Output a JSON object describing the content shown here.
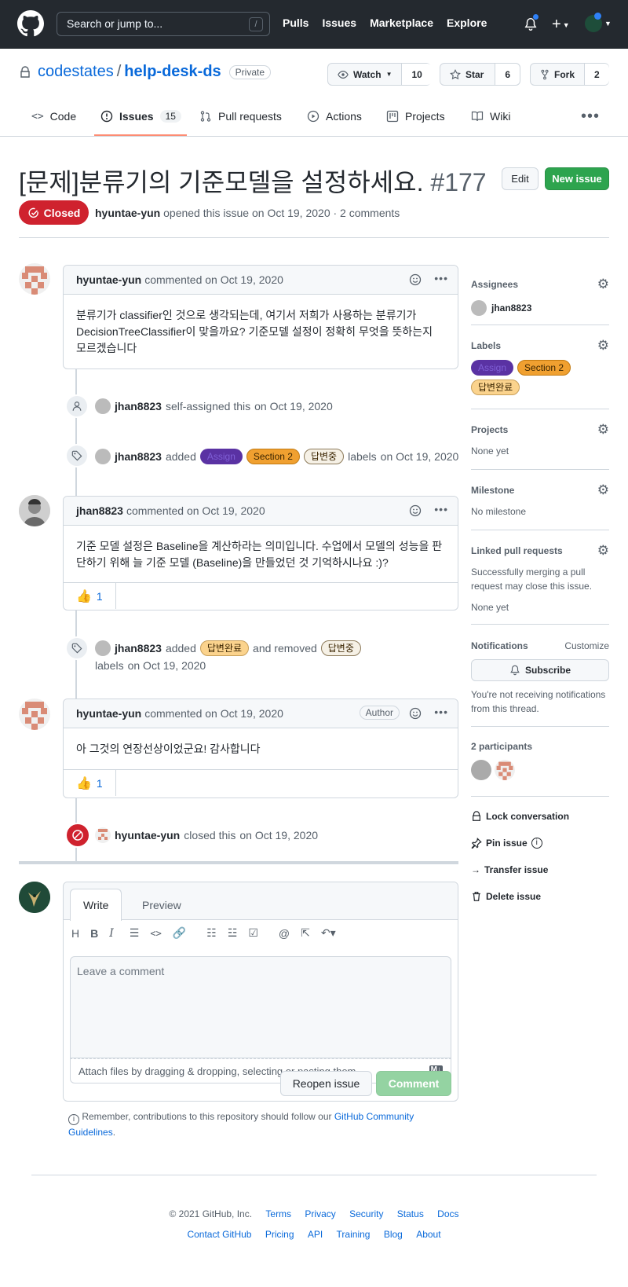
{
  "header": {
    "search_placeholder": "Search or jump to...",
    "slash": "/",
    "nav": [
      "Pulls",
      "Issues",
      "Marketplace",
      "Explore"
    ]
  },
  "repo": {
    "owner": "codestates",
    "sep": "/",
    "name": "help-desk-ds",
    "visibility": "Private",
    "watch_label": "Watch",
    "watch_count": "10",
    "star_label": "Star",
    "star_count": "6",
    "fork_label": "Fork",
    "fork_count": "2"
  },
  "tabs": [
    {
      "label": "Code"
    },
    {
      "label": "Issues",
      "count": "15"
    },
    {
      "label": "Pull requests"
    },
    {
      "label": "Actions"
    },
    {
      "label": "Projects"
    },
    {
      "label": "Wiki"
    }
  ],
  "issue": {
    "title": "[문제]분류기의 기준모델을 설정하세요.",
    "number": "#177",
    "edit_label": "Edit",
    "new_issue_label": "New issue",
    "state": "Closed",
    "author": "hyuntae-yun",
    "meta_rest": "opened this issue on Oct 19, 2020 · 2 comments"
  },
  "comments": [
    {
      "author": "hyuntae-yun",
      "when": "commented on Oct 19, 2020",
      "body": "분류기가 classifier인 것으로 생각되는데, 여기서 저희가 사용하는 분류기가 DecisionTreeClassifier이 맞을까요? 기준모델 설정이 정확히 무엇을 뜻하는지 모르겠습니다"
    },
    {
      "author": "jhan8823",
      "when": "commented on Oct 19, 2020",
      "body": "기준 모델 설정은 Baseline을 계산하라는 의미입니다. 수업에서 모델의 성능을 판단하기 위해 늘 기준 모델 (Baseline)을 만들었던 것 기억하시나요 :)?",
      "reaction": "1"
    },
    {
      "author": "hyuntae-yun",
      "when": "commented on Oct 19, 2020",
      "badge": "Author",
      "body": "아 그것의 연장선상이었군요! 감사합니다",
      "reaction": "1"
    }
  ],
  "events": {
    "assign": {
      "actor": "jhan8823",
      "text": "self-assigned this",
      "when": "on Oct 19, 2020"
    },
    "labels1": {
      "actor": "jhan8823",
      "verb": "added",
      "tail": "labels",
      "when": "on Oct 19, 2020"
    },
    "labels2": {
      "actor": "jhan8823",
      "verb": "added",
      "mid": "and removed",
      "tail": "labels",
      "when": "on Oct 19, 2020"
    },
    "closed": {
      "actor": "hyuntae-yun",
      "text": "closed this",
      "when": "on Oct 19, 2020"
    }
  },
  "labels": {
    "assign": {
      "name": "Assign",
      "bg": "#5a32a3",
      "fg": "#7f5fd6"
    },
    "section2": {
      "name": "Section 2",
      "bg": "#f0a030",
      "fg": "#3a2400"
    },
    "answered": {
      "name": "답변완료",
      "bg": "#fbd38d",
      "fg": "#3a2400"
    },
    "answering": {
      "name": "답변중",
      "bg": "#f6f1e6",
      "fg": "#3a2400"
    }
  },
  "sidebar": {
    "assignees_title": "Assignees",
    "assignee": "jhan8823",
    "labels_title": "Labels",
    "projects_title": "Projects",
    "projects_value": "None yet",
    "milestone_title": "Milestone",
    "milestone_value": "No milestone",
    "linked_title": "Linked pull requests",
    "linked_text": "Successfully merging a pull request may close this issue.",
    "linked_value": "None yet",
    "notifications_title": "Notifications",
    "customize": "Customize",
    "subscribe": "Subscribe",
    "notif_text": "You're not receiving notifications from this thread.",
    "participants": "2 participants",
    "lock": "Lock conversation",
    "pin": "Pin issue",
    "transfer": "Transfer issue",
    "delete": "Delete issue"
  },
  "editor": {
    "tab_write": "Write",
    "tab_preview": "Preview",
    "placeholder": "Leave a comment",
    "attach": "Attach files by dragging & dropping, selecting or pasting them.",
    "reopen": "Reopen issue",
    "comment": "Comment",
    "guidelines_prefix": "Remember, contributions to this repository should follow our",
    "guidelines_link": "GitHub Community Guidelines",
    "guidelines_suffix": "."
  },
  "footer": {
    "copyright": "© 2021 GitHub, Inc.",
    "row1": [
      "Terms",
      "Privacy",
      "Security",
      "Status",
      "Docs"
    ],
    "row2": [
      "Contact GitHub",
      "Pricing",
      "API",
      "Training",
      "Blog",
      "About"
    ]
  },
  "colors": {
    "topbar": "#24292f",
    "closed": "#cf222e",
    "green": "#2da44e",
    "link": "#0969da"
  }
}
